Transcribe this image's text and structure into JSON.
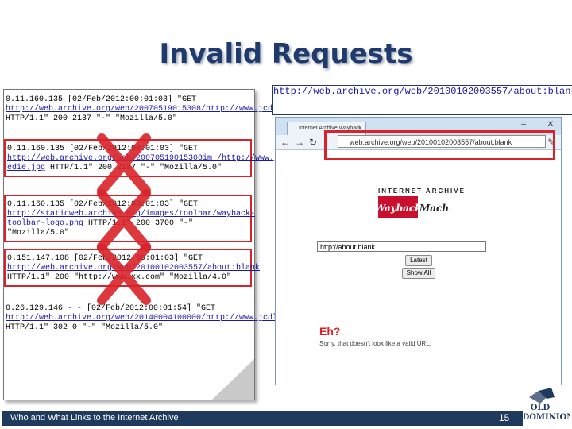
{
  "title": "Invalid Requests",
  "log_entries": [
    {
      "pre": "0.11.160.135 [02/Feb/2012:00:01:03] \"GET ",
      "url": "http://web.archive.org/web/20070519015308/http://www.jcdl.org/",
      "post": " HTTP/1.1\" 200 2137 \"-\" \"Mozilla/5.0\"",
      "invalid": false
    },
    {
      "pre": "0.11.160.135 [02/Feb/2012:00:01:03] \"GET ",
      "url": "http://web.archive.org/web/20070519015308im_/http://www.jcdl.org/images/jcdl2007-edie.jpg",
      "post": " HTTP/1.1\" 200 2137 \"-\" \"Mozilla/5.0\"",
      "invalid": true
    },
    {
      "pre": "0.11.160.135 [02/Feb/2012:00:01:03] \"GET ",
      "url": "http://staticweb.archive.org/images/toolbar/wayback-toolbar-logo.png",
      "post": " HTTP/1.1\" 200 3700 \"-\" \"Mozilla/5.0\"",
      "invalid": true
    },
    {
      "pre": "0.151.147.108 [02/Feb/2012:00:01:03] \"GET ",
      "url": "http://web.archive.org/web/20100102003557/about:blank",
      "post": " HTTP/1.1\" 200 \"http://www.xx.com\" \"Mozilla/4.0\"",
      "invalid": true
    },
    {
      "pre": "0.26.129.146 - - [02/Feb/2012:00:01:54] \"GET ",
      "url": "http://web.archive.org/web/20140004100000/http://www.jcdl.org/",
      "post": " HTTP/1.1\" 302 0 \"-\" \"Mozilla/5.0\"",
      "invalid": false
    }
  ],
  "highlight_url": "http://web.archive.org/web/20100102003557/about:blank",
  "browser": {
    "tab_title": "Internet Archive Wayback",
    "address": "web.archive.org/web/20100102003557/about:blank",
    "ia_label": "INTERNET ARCHIVE",
    "logo_text_1": "Wayback",
    "logo_text_2": "Machine",
    "search_value": "http://about:blank",
    "latest_button": "Latest",
    "show_all_button": "Show All",
    "error_title": "Eh?",
    "error_message": "Sorry, that doesn't look like a valid URL."
  },
  "footer": {
    "text": "Who and What Links to the Internet Archive",
    "page": "15",
    "logo_text_1": "OLD",
    "logo_text_2": "DOMINION"
  },
  "colors": {
    "title": "#1f3b6e",
    "invalid_mark": "#d9232a",
    "footer_bg": "#1f3a5c",
    "link": "#1a1aa8"
  }
}
